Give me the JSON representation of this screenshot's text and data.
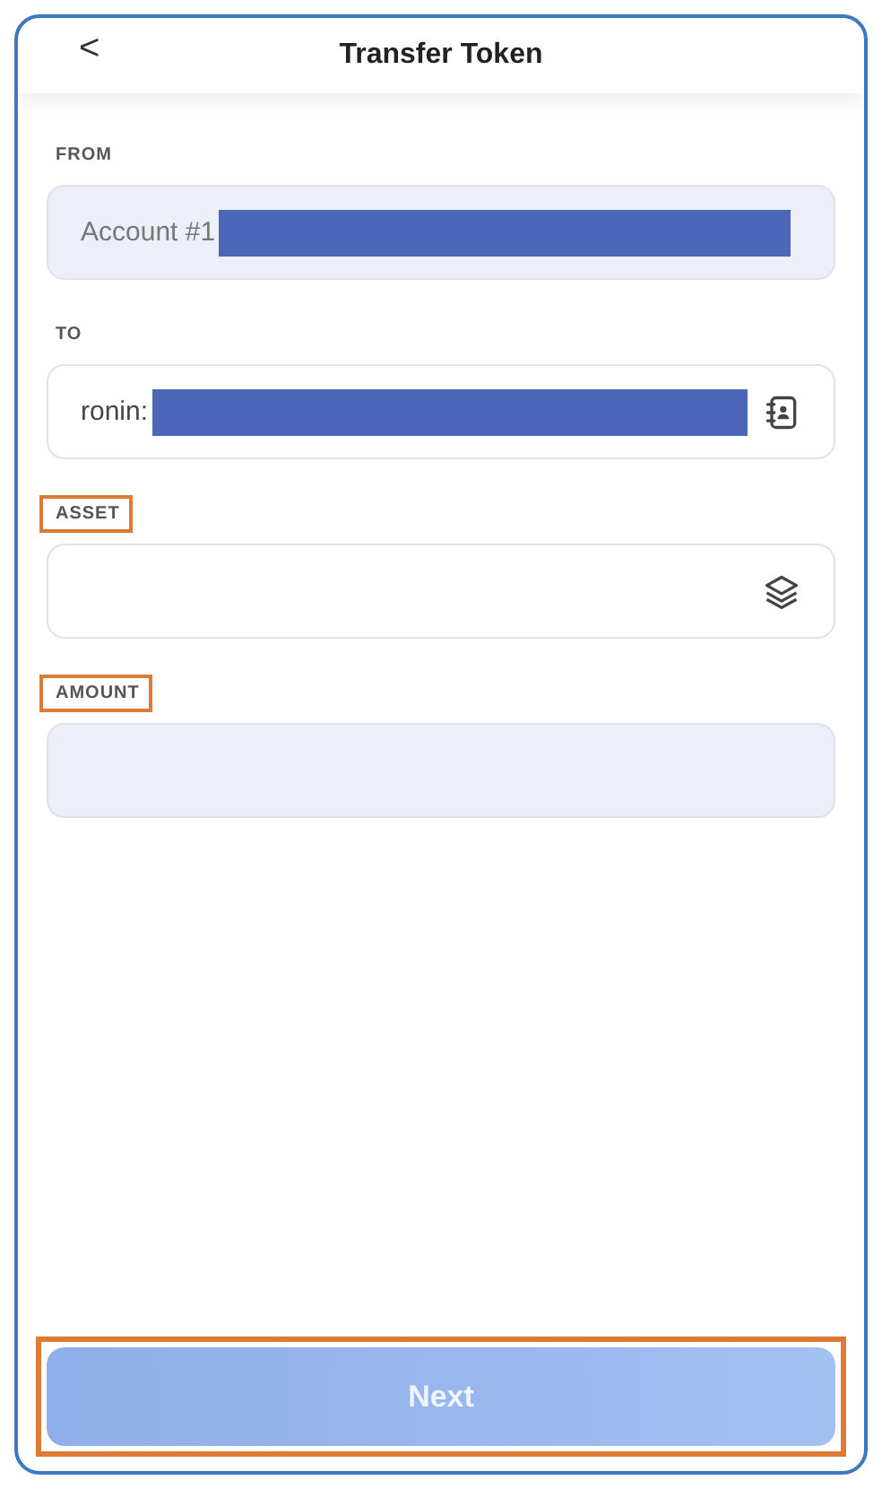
{
  "header": {
    "back": "<",
    "title": "Transfer Token"
  },
  "fields": [
    {
      "kind": "account",
      "label": "FROM",
      "value": "Account #1",
      "redacted": true,
      "disabled": true,
      "highlighted": false
    },
    {
      "kind": "address",
      "label": "TO",
      "value": "ronin:",
      "redacted": true,
      "disabled": false,
      "highlighted": false
    },
    {
      "kind": "asset",
      "label": "ASSET",
      "redacted": false,
      "disabled": false,
      "highlighted": true
    },
    {
      "kind": "amount",
      "label": "AMOUNT",
      "redacted": false,
      "disabled": true,
      "highlighted": true
    }
  ],
  "next_button": {
    "label": "Next",
    "disabled": true,
    "highlighted": true
  }
}
